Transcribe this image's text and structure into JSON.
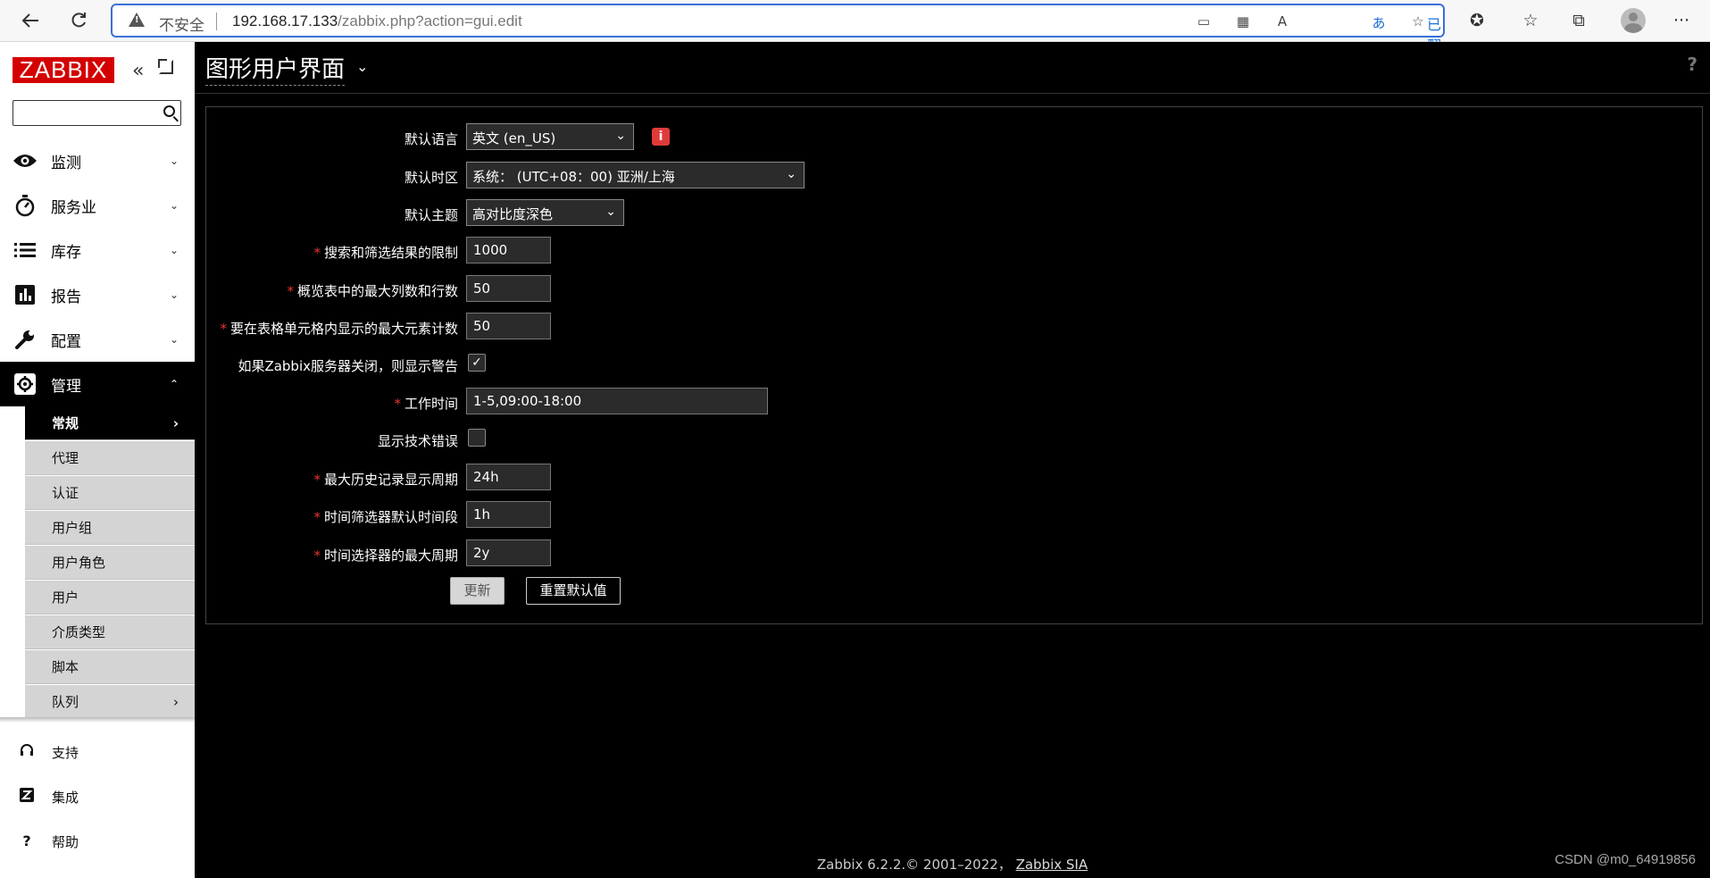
{
  "browser": {
    "insecure_label": "不安全",
    "url_host": "192.168.17.133",
    "url_path": "/zabbix.php?action=gui.edit",
    "translate_label": "已翻译"
  },
  "sidebar": {
    "logo": "ZABBIX",
    "search_placeholder": "",
    "menu": [
      {
        "label": "监测",
        "icon": "eye-icon"
      },
      {
        "label": "服务业",
        "icon": "stopwatch-icon"
      },
      {
        "label": "库存",
        "icon": "list-icon"
      },
      {
        "label": "报告",
        "icon": "bar-chart-icon"
      },
      {
        "label": "配置",
        "icon": "wrench-icon"
      },
      {
        "label": "管理",
        "icon": "gear-icon"
      }
    ],
    "submenu": [
      "常规",
      "代理",
      "认证",
      "用户组",
      "用户角色",
      "用户",
      "介质类型",
      "脚本",
      "队列"
    ],
    "footer": [
      {
        "label": "支持",
        "icon": "headset-icon"
      },
      {
        "label": "集成",
        "icon": "z-icon"
      },
      {
        "label": "帮助",
        "icon": "question-icon"
      }
    ]
  },
  "page": {
    "title": "图形用户界面",
    "help": "?"
  },
  "form": {
    "default_language": {
      "label": "默认语言",
      "value": "英文 (en_US)"
    },
    "default_timezone": {
      "label": "默认时区",
      "value": "系统： (UTC+08：00) 亚洲/上海"
    },
    "default_theme": {
      "label": "默认主题",
      "value": "高对比度深色"
    },
    "search_limit": {
      "label": "搜索和筛选结果的限制",
      "value": "1000"
    },
    "max_columns_rows": {
      "label": "概览表中的最大列数和行数",
      "value": "50"
    },
    "max_elements_cell": {
      "label": "要在表格单元格内显示的最大元素计数",
      "value": "50"
    },
    "server_down_warning": {
      "label": "如果Zabbix服务器关闭，则显示警告",
      "checked": true
    },
    "working_time": {
      "label": "工作时间",
      "value": "1-5,09:00-18:00"
    },
    "show_tech_errors": {
      "label": "显示技术错误",
      "checked": false
    },
    "max_history_period": {
      "label": "最大历史记录显示周期",
      "value": "24h"
    },
    "time_filter_default": {
      "label": "时间筛选器默认时间段",
      "value": "1h"
    },
    "max_period": {
      "label": "时间选择器的最大周期",
      "value": "2y"
    },
    "update_label": "更新",
    "reset_label": "重置默认值"
  },
  "footer": {
    "copyright": "Zabbix 6.2.2.© 2001–2022，",
    "company": "Zabbix SIA"
  },
  "watermark": "CSDN @m0_64919856"
}
